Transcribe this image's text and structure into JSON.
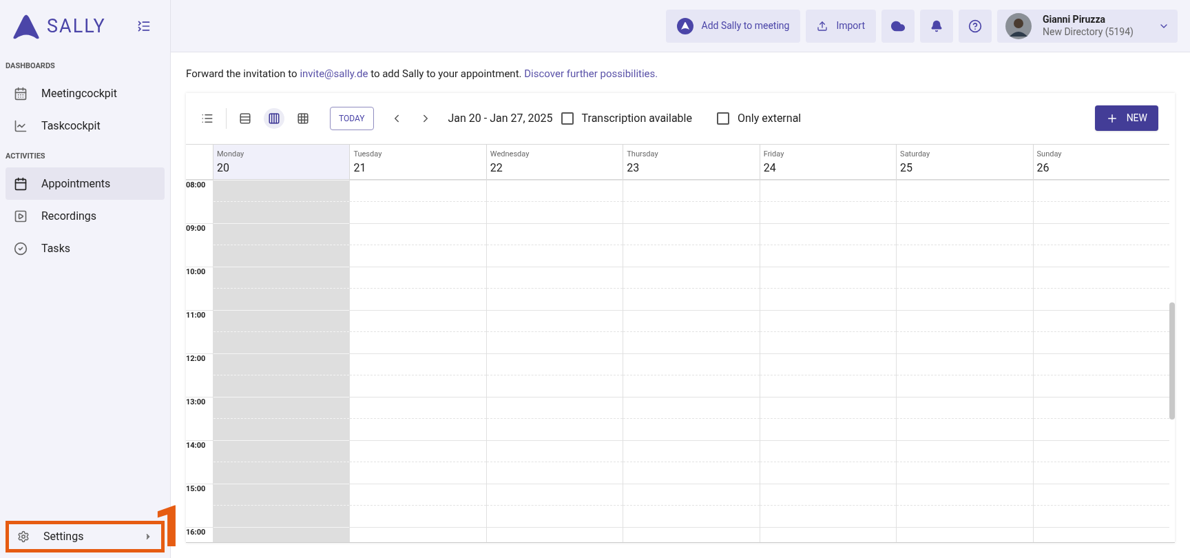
{
  "brand": {
    "name": "SALLY"
  },
  "sidebar": {
    "sections": [
      {
        "title": "DASHBOARDS",
        "items": [
          {
            "kind": "calendar-small",
            "label": "Meetingcockpit",
            "selected": false
          },
          {
            "kind": "chart",
            "label": "Taskcockpit",
            "selected": false
          }
        ]
      },
      {
        "title": "ACTIVITIES",
        "items": [
          {
            "kind": "calendar",
            "label": "Appointments",
            "selected": true
          },
          {
            "kind": "video",
            "label": "Recordings",
            "selected": false
          },
          {
            "kind": "check",
            "label": "Tasks",
            "selected": false
          }
        ]
      }
    ],
    "settings": {
      "label": "Settings",
      "highlighted": true
    }
  },
  "annotation": {
    "label": "1"
  },
  "topbar": {
    "add_button": "Add Sally to meeting",
    "import_button": "Import",
    "user": {
      "name": "Gianni Piruzza",
      "directory": "New Directory (5194)"
    }
  },
  "notice": [
    {
      "kind": "text",
      "text": "Forward the invitation to"
    },
    {
      "kind": "link",
      "text": "invite@sally.de"
    },
    {
      "kind": "text",
      "text": "to add Sally to your appointment."
    },
    {
      "kind": "link",
      "text": "Discover further possibilities."
    }
  ],
  "toolbar": {
    "views": [
      {
        "kind": "list",
        "selected": false
      },
      {
        "kind": "day",
        "selected": false
      },
      {
        "kind": "week",
        "selected": true
      },
      {
        "kind": "month",
        "selected": false
      }
    ],
    "today": "TODAY",
    "range": "Jan 20 - Jan 27, 2025",
    "filters": [
      {
        "label": "Transcription available",
        "checked": false
      },
      {
        "label": "Only external",
        "checked": false
      }
    ],
    "new_button": "NEW"
  },
  "calendar": {
    "days": [
      {
        "name": "Monday",
        "date": "20",
        "selected": true,
        "past": true
      },
      {
        "name": "Tuesday",
        "date": "21",
        "selected": false,
        "past": false
      },
      {
        "name": "Wednesday",
        "date": "22",
        "selected": false,
        "past": false
      },
      {
        "name": "Thursday",
        "date": "23",
        "selected": false,
        "past": false
      },
      {
        "name": "Friday",
        "date": "24",
        "selected": false,
        "past": false
      },
      {
        "name": "Saturday",
        "date": "25",
        "selected": false,
        "past": false
      },
      {
        "name": "Sunday",
        "date": "26",
        "selected": false,
        "past": false
      }
    ],
    "hours": [
      "08:00",
      "09:00",
      "10:00",
      "11:00",
      "12:00",
      "13:00",
      "14:00",
      "15:00",
      "16:00"
    ]
  }
}
